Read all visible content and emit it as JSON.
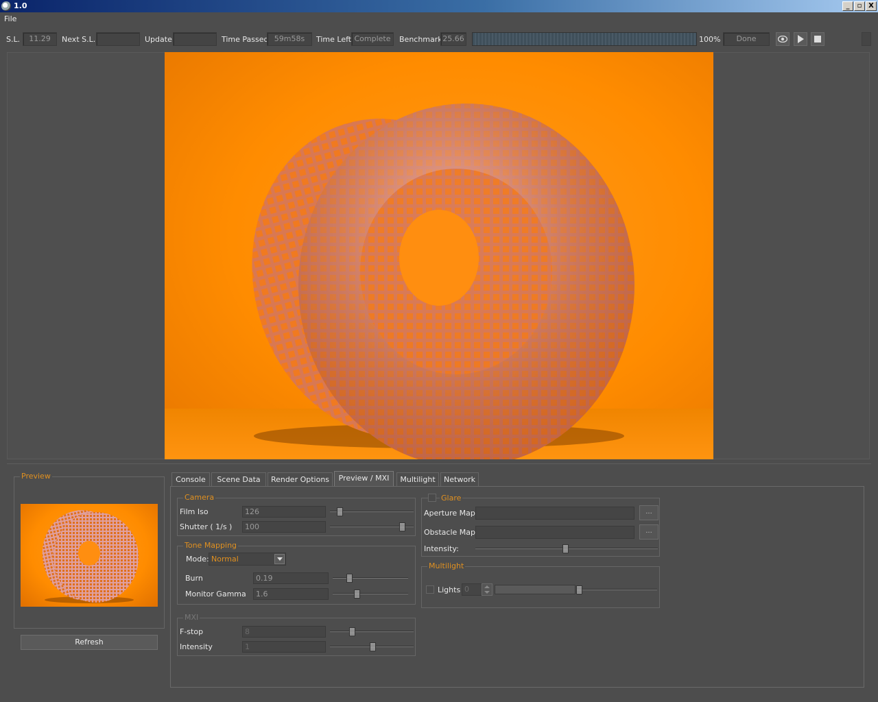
{
  "window": {
    "title": "1.0",
    "minimize": "_",
    "restore": "▫",
    "close": "X"
  },
  "menu": {
    "file": "File"
  },
  "status": {
    "sl_label": "S.L.",
    "sl_value": "11.29",
    "next_sl_label": "Next S.L.",
    "next_sl_value": "",
    "update_label": "Update",
    "update_value": "",
    "time_passed_label": "Time Passed",
    "time_passed_value": "59m58s",
    "time_left_label": "Time Left",
    "time_left_value": "Complete",
    "benchmark_label": "Benchmark",
    "benchmark_value": "25.66",
    "progress_percent": "100%",
    "progress_fraction": 1.0,
    "state_value": "Done"
  },
  "preview": {
    "title": "Preview",
    "refresh_label": "Refresh"
  },
  "tabs": [
    {
      "label": "Console"
    },
    {
      "label": "Scene Data"
    },
    {
      "label": "Render Options"
    },
    {
      "label": "Preview / MXI"
    },
    {
      "label": "Multilight"
    },
    {
      "label": "Network"
    }
  ],
  "camera": {
    "title": "Camera",
    "film_iso_label": "Film Iso",
    "film_iso_value": "126",
    "shutter_label": "Shutter ( 1/s )",
    "shutter_value": "100"
  },
  "tone_mapping": {
    "title": "Tone Mapping",
    "mode_label": "Mode:",
    "mode_value": "Normal",
    "burn_label": "Burn",
    "burn_value": "0.19",
    "gamma_label": "Monitor Gamma",
    "gamma_value": "1.6"
  },
  "mxi": {
    "title": "MXI",
    "fstop_label": "F-stop",
    "fstop_value": "8",
    "intensity_label": "Intensity",
    "intensity_value": "1"
  },
  "glare": {
    "title": "Glare",
    "aperture_label": "Aperture Map:",
    "aperture_value": "",
    "obstacle_label": "Obstacle Map:",
    "obstacle_value": "",
    "browse_label": "...",
    "intensity_label": "Intensity:"
  },
  "multilight": {
    "title": "Multilight",
    "lights_label": "Lights",
    "lights_value": "0"
  },
  "colors": {
    "accent": "#e09020",
    "render_bg": "#ff8c00",
    "panel": "#4d4d4d"
  }
}
